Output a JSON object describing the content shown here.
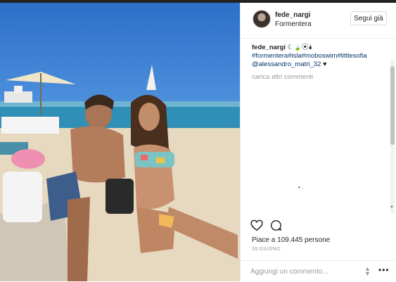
{
  "post": {
    "username": "fede_nargi",
    "location": "Formentera",
    "follow_label": "Segui già"
  },
  "caption": {
    "username": "fede_nargi",
    "emoji": "☾🍃⦿🌢",
    "hashtags": "#formentera#isla#moboswim#littlesofia",
    "mention": "@alessandro_matri_32",
    "heart": "♥"
  },
  "load_more": "carica altri commenti",
  "likes": "Piace a 109.445 persone",
  "date": "28 GIUGNO",
  "comment_input": {
    "placeholder": "Aggiungi un commento..."
  },
  "icons": {
    "like": "heart-icon",
    "comment": "comment-icon",
    "more": "more-options-icon",
    "location_sort": "updown-icon"
  },
  "colors": {
    "link": "#003569",
    "muted": "#999999",
    "text": "#262626"
  }
}
